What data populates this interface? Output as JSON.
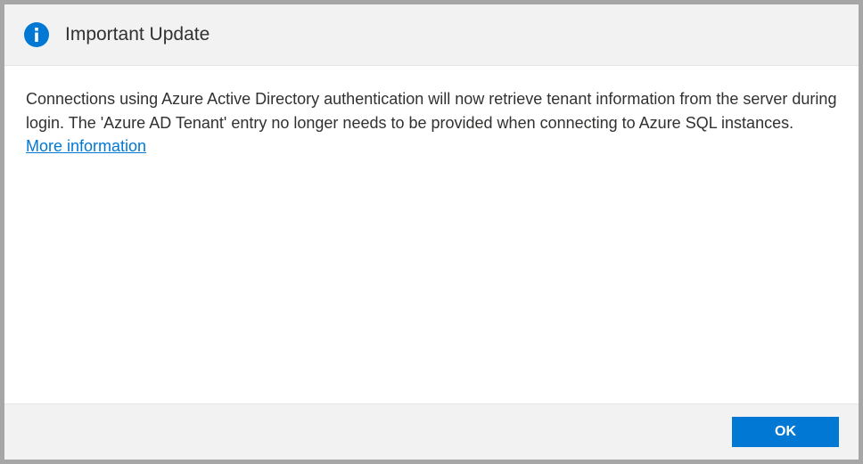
{
  "header": {
    "title": "Important Update",
    "icon": "info-icon"
  },
  "body": {
    "message": "Connections using Azure Active Directory authentication will now retrieve tenant information from the server during login. The 'Azure AD Tenant' entry no longer needs to be provided when connecting to Azure SQL instances.",
    "link_label": "More information"
  },
  "footer": {
    "ok_label": "OK"
  },
  "colors": {
    "accent": "#0078d4",
    "header_bg": "#f2f2f2",
    "border": "#a6a6a6"
  }
}
